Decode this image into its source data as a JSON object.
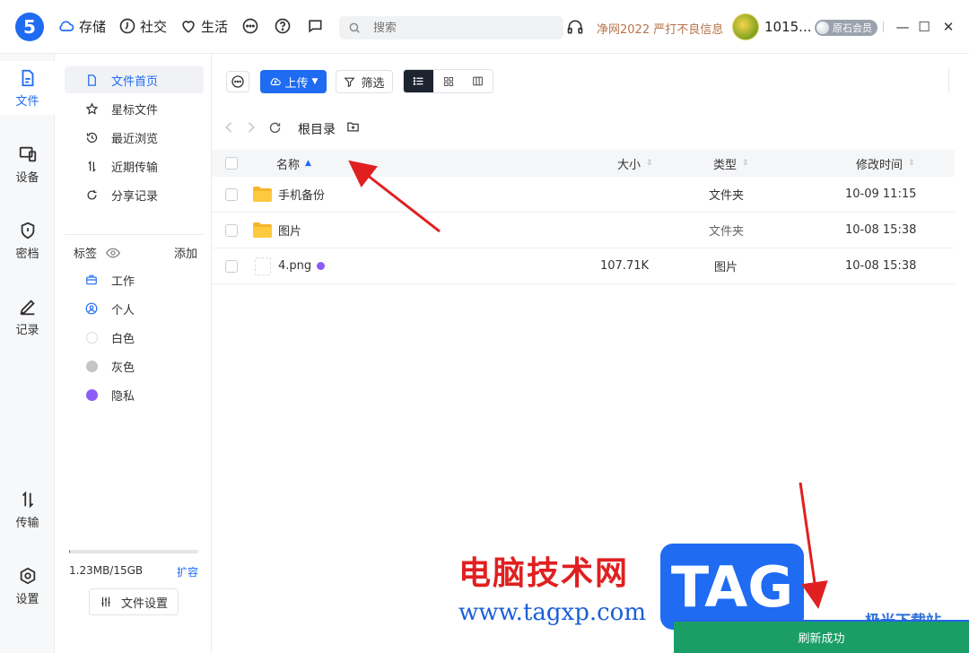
{
  "topbar": {
    "logo": "5",
    "nav": [
      {
        "label": "存储",
        "icon": "cloud-icon"
      },
      {
        "label": "社交",
        "icon": "clock-icon"
      },
      {
        "label": "生活",
        "icon": "heart-icon"
      }
    ],
    "search_placeholder": "搜索",
    "promo": "净网2022 严打不良信息",
    "username": "1015...",
    "vip": "原石会员",
    "window": {
      "minimize": "—",
      "maximize": "☐",
      "close": "✕"
    }
  },
  "rail": {
    "items": [
      {
        "label": "文件",
        "icon": "file-icon",
        "active": true
      },
      {
        "label": "设备",
        "icon": "device-icon"
      },
      {
        "label": "密档",
        "icon": "shield-icon"
      },
      {
        "label": "记录",
        "icon": "pen-icon"
      },
      {
        "label": "传输",
        "icon": "transfer-icon"
      },
      {
        "label": "设置",
        "icon": "settings-icon"
      }
    ]
  },
  "side": {
    "items": [
      {
        "label": "文件首页",
        "icon": "document-icon",
        "active": true
      },
      {
        "label": "星标文件",
        "icon": "star-icon"
      },
      {
        "label": "最近浏览",
        "icon": "history-icon"
      },
      {
        "label": "近期传输",
        "icon": "transfer-icon"
      },
      {
        "label": "分享记录",
        "icon": "share-icon"
      }
    ],
    "tags_title": "标签",
    "tags_add": "添加",
    "tags": [
      {
        "label": "工作",
        "icon": "briefcase-icon"
      },
      {
        "label": "个人",
        "icon": "person-icon"
      },
      {
        "label": "白色",
        "color": "#ffffff"
      },
      {
        "label": "灰色",
        "color": "#c4c4c4"
      },
      {
        "label": "隐私",
        "color": "#8b5cf6"
      }
    ],
    "storage_text": "1.23MB/15GB",
    "storage_used": 0.0001,
    "expand": "扩容",
    "file_settings": "文件设置"
  },
  "toolbar": {
    "upload": "上传",
    "filter": "筛选"
  },
  "path": {
    "crumb": "根目录"
  },
  "table": {
    "headers": {
      "name": "名称",
      "size": "大小",
      "type": "类型",
      "modified": "修改时间"
    },
    "rows": [
      {
        "name": "手机备份",
        "size": "",
        "type": "文件夹",
        "modified": "10-09 11:15",
        "kind": "folder"
      },
      {
        "name": "图片",
        "size": "",
        "type": "文件夹",
        "modified": "10-08 15:38",
        "kind": "folder"
      },
      {
        "name": "4.png",
        "size": "107.71K",
        "type": "图片",
        "modified": "10-08 15:38",
        "kind": "image"
      }
    ]
  },
  "watermark": {
    "cn": "电脑技术网",
    "url": "www.tagxp.com",
    "tag": "TAG",
    "site": "极光下载站"
  },
  "toast": "刷新成功",
  "colors": {
    "accent": "#1f6bf2",
    "toast": "#1a9e66",
    "annotation": "#e02020"
  }
}
